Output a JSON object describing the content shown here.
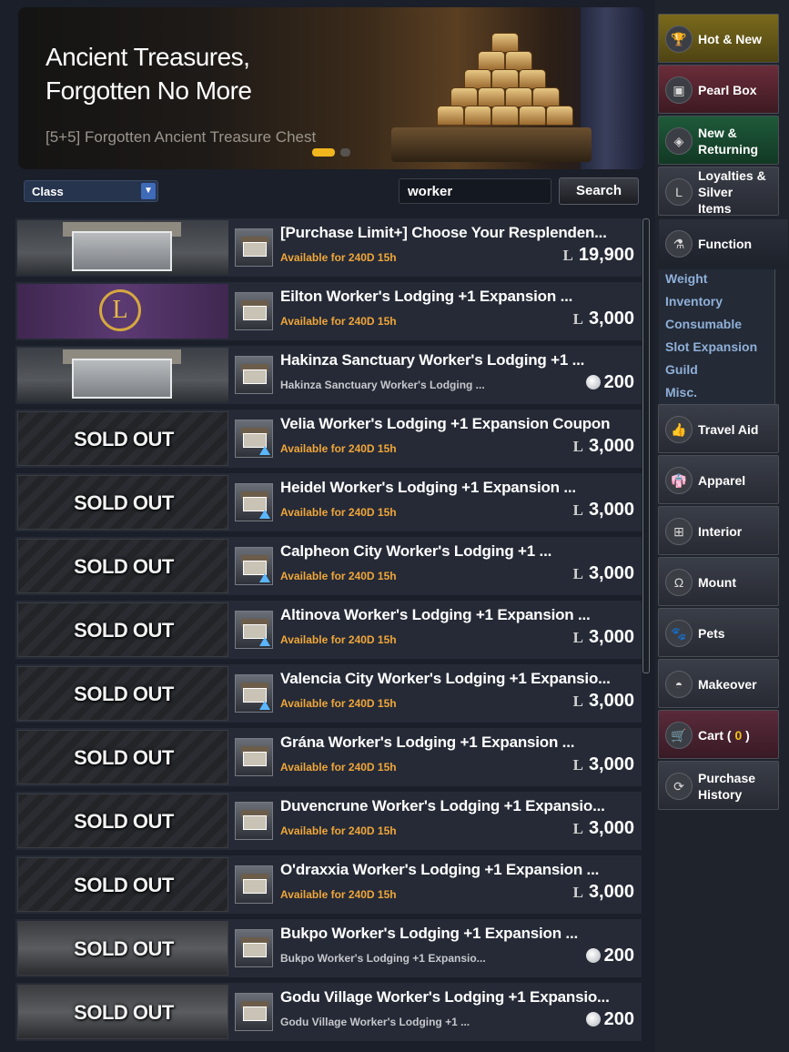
{
  "banner": {
    "title_line1": "Ancient Treasures,",
    "title_line2": "Forgotten No More",
    "subtitle": "[5+5] Forgotten Ancient Treasure Chest"
  },
  "filter": {
    "class_label": "Class",
    "search_value": "worker",
    "search_button": "Search"
  },
  "items": [
    {
      "name": "[Purchase Limit+] Choose Your Resplenden...",
      "avail": "Available for 240D 15h",
      "currency": "L",
      "price": "19,900",
      "sold": false
    },
    {
      "name": "Eilton Worker's Lodging +1 Expansion ...",
      "avail": "Available for 240D 15h",
      "currency": "L",
      "price": "3,000",
      "sold": false
    },
    {
      "name": "Hakinza Sanctuary Worker's Lodging +1 ...",
      "avail": "Hakinza Sanctuary Worker's Lodging ...",
      "currency": "pearl",
      "price": "200",
      "sold": false
    },
    {
      "name": "Velia Worker's Lodging +1 Expansion Coupon",
      "avail": "Available for 240D 15h",
      "currency": "L",
      "price": "3,000",
      "sold": true
    },
    {
      "name": "Heidel Worker's Lodging +1 Expansion ...",
      "avail": "Available for 240D 15h",
      "currency": "L",
      "price": "3,000",
      "sold": true
    },
    {
      "name": "Calpheon City Worker's Lodging +1 ...",
      "avail": "Available for 240D 15h",
      "currency": "L",
      "price": "3,000",
      "sold": true
    },
    {
      "name": "Altinova Worker's Lodging +1 Expansion ...",
      "avail": "Available for 240D 15h",
      "currency": "L",
      "price": "3,000",
      "sold": true
    },
    {
      "name": "Valencia City Worker's Lodging +1 Expansio...",
      "avail": "Available for 240D 15h",
      "currency": "L",
      "price": "3,000",
      "sold": true
    },
    {
      "name": "Grána Worker's Lodging +1 Expansion ...",
      "avail": "Available for 240D 15h",
      "currency": "L",
      "price": "3,000",
      "sold": true
    },
    {
      "name": "Duvencrune Worker's Lodging +1 Expansio...",
      "avail": "Available for 240D 15h",
      "currency": "L",
      "price": "3,000",
      "sold": true
    },
    {
      "name": "O'draxxia Worker's Lodging +1 Expansion ...",
      "avail": "Available for 240D 15h",
      "currency": "L",
      "price": "3,000",
      "sold": true
    },
    {
      "name": "Bukpo Worker's Lodging +1 Expansion ...",
      "avail": "Bukpo Worker's Lodging +1 Expansio...",
      "currency": "pearl",
      "price": "200",
      "sold": true
    },
    {
      "name": "Godu Village Worker's Lodging +1 Expansio...",
      "avail": "Godu Village Worker's Lodging +1 ...",
      "currency": "pearl",
      "price": "200",
      "sold": true
    }
  ],
  "sold_out_label": "SOLD OUT",
  "categories": {
    "hot_new": "Hot & New",
    "pearl_box": "Pearl Box",
    "new_returning_1": "New &",
    "new_returning_2": "Returning",
    "loyalties_1": "Loyalties &",
    "loyalties_2": "Silver",
    "loyalties_3": "Items",
    "function": "Function",
    "travel_aid": "Travel Aid",
    "apparel": "Apparel",
    "interior": "Interior",
    "mount": "Mount",
    "pets": "Pets",
    "makeover": "Makeover",
    "cart": "Cart",
    "cart_count": "0",
    "purchase_history_1": "Purchase",
    "purchase_history_2": "History"
  },
  "function_sub": [
    "Weight",
    "Inventory",
    "Consumable",
    "Slot Expansion",
    "Guild",
    "Misc."
  ]
}
